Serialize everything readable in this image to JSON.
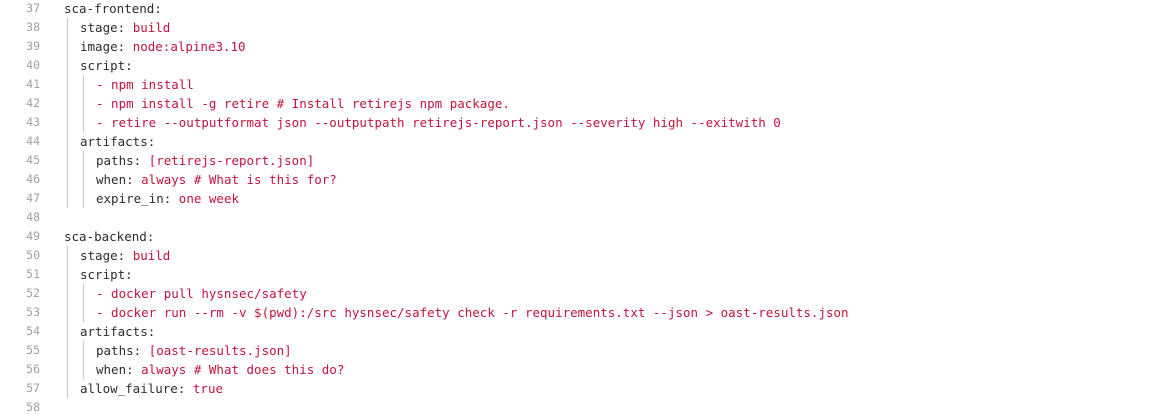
{
  "lines": [
    {
      "n": "37",
      "indent": 0,
      "key": "sca-frontend:",
      "val": ""
    },
    {
      "n": "38",
      "indent": 1,
      "key": "stage: ",
      "val": "build"
    },
    {
      "n": "39",
      "indent": 1,
      "key": "image: ",
      "val": "node:alpine3.10"
    },
    {
      "n": "40",
      "indent": 1,
      "key": "script:",
      "val": ""
    },
    {
      "n": "41",
      "indent": 2,
      "key": "",
      "val": "- npm install"
    },
    {
      "n": "42",
      "indent": 2,
      "key": "",
      "val": "- npm install -g retire # Install retirejs npm package."
    },
    {
      "n": "43",
      "indent": 2,
      "key": "",
      "val": "- retire --outputformat json --outputpath retirejs-report.json --severity high --exitwith 0"
    },
    {
      "n": "44",
      "indent": 1,
      "key": "artifacts:",
      "val": ""
    },
    {
      "n": "45",
      "indent": 2,
      "key": "paths: ",
      "val": "[retirejs-report.json]"
    },
    {
      "n": "46",
      "indent": 2,
      "key": "when: ",
      "val": "always # What is this for?"
    },
    {
      "n": "47",
      "indent": 2,
      "key": "expire_in: ",
      "val": "one week"
    },
    {
      "n": "48",
      "indent": 0,
      "key": "",
      "val": ""
    },
    {
      "n": "49",
      "indent": 0,
      "key": "sca-backend:",
      "val": ""
    },
    {
      "n": "50",
      "indent": 1,
      "key": "stage: ",
      "val": "build"
    },
    {
      "n": "51",
      "indent": 1,
      "key": "script:",
      "val": ""
    },
    {
      "n": "52",
      "indent": 2,
      "key": "",
      "val": "- docker pull hysnsec/safety"
    },
    {
      "n": "53",
      "indent": 2,
      "key": "",
      "val": "- docker run --rm -v $(pwd):/src hysnsec/safety check -r requirements.txt --json > oast-results.json"
    },
    {
      "n": "54",
      "indent": 1,
      "key": "artifacts:",
      "val": ""
    },
    {
      "n": "55",
      "indent": 2,
      "key": "paths: ",
      "val": "[oast-results.json]"
    },
    {
      "n": "56",
      "indent": 2,
      "key": "when: ",
      "val": "always # What does this do?"
    },
    {
      "n": "57",
      "indent": 1,
      "key": "allow_failure: ",
      "val": "true"
    },
    {
      "n": "58",
      "indent": 0,
      "key": "",
      "val": ""
    }
  ]
}
